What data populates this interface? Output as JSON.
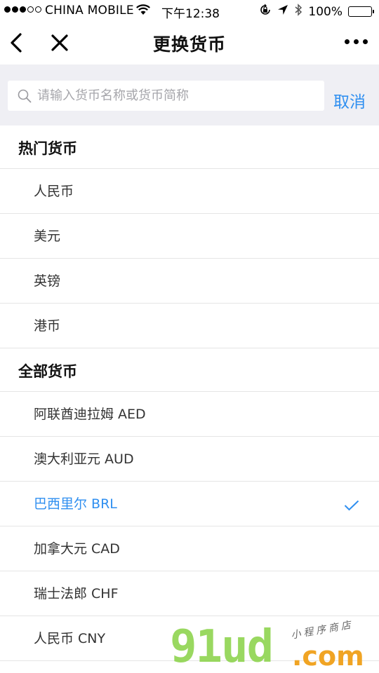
{
  "status_bar": {
    "carrier": "CHINA MOBILE",
    "time": "下午12:38",
    "battery": "100%"
  },
  "nav": {
    "title": "更换货币"
  },
  "search": {
    "placeholder": "请输入货币名称或货币简称",
    "value": "",
    "cancel_label": "取消"
  },
  "sections": {
    "popular": {
      "title": "热门货币",
      "items": [
        "人民币",
        "美元",
        "英镑",
        "港币"
      ]
    },
    "all": {
      "title": "全部货币",
      "items": [
        "阿联酋迪拉姆 AED",
        "澳大利亚元 AUD",
        "巴西里尔 BRL",
        "加拿大元 CAD",
        "瑞士法郎 CHF",
        "人民币 CNY"
      ],
      "selected_index": 2
    }
  },
  "watermark": {
    "logo": "91ud",
    "domain": ".com",
    "tagline": "小程序商店"
  },
  "colors": {
    "accent": "#2f8ff0",
    "search_bg": "#efeff4",
    "divider": "#e5e5e5"
  }
}
